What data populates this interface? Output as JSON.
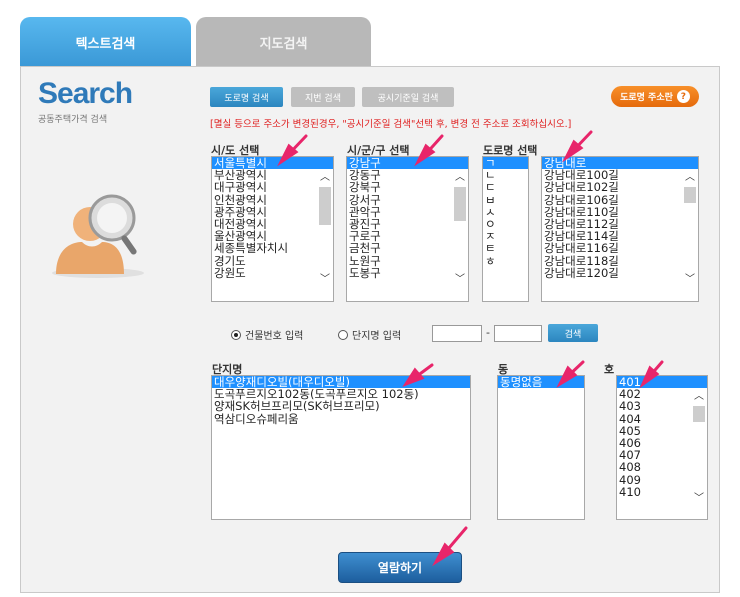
{
  "tabs": {
    "text_search": "텍스트검색",
    "map_search": "지도검색"
  },
  "brand": {
    "title": "Search",
    "subtitle": "공동주택가격 검색"
  },
  "buttons": {
    "road_search": "도로명 검색",
    "jibun_search": "지번 검색",
    "date_search": "공시기준일 검색",
    "road_address": "도로명 주소란",
    "search": "검색",
    "open": "열람하기"
  },
  "notice": "[멸실 등으로 주소가 변경된경우, \"공시기준일 검색\"선택 후, 변경 전 주소로 조회하십시오.]",
  "labels": {
    "sido": "시/도 선택",
    "sigungu": "시/군/구 선택",
    "road": "도로명 선택",
    "danji": "단지명",
    "dong": "동",
    "ho": "호"
  },
  "sido_list": [
    "서울특별시",
    "부산광역시",
    "대구광역시",
    "인천광역시",
    "광주광역시",
    "대전광역시",
    "울산광역시",
    "세종특별자치시",
    "경기도",
    "강원도"
  ],
  "sigungu_list": [
    "강남구",
    "강동구",
    "강북구",
    "강서구",
    "관악구",
    "광진구",
    "구로구",
    "금천구",
    "노원구",
    "도봉구"
  ],
  "initial_list": [
    "ㄱ",
    "ㄴ",
    "ㄷ",
    "ㅂ",
    "ㅅ",
    "ㅇ",
    "ㅈ",
    "ㅌ",
    "ㅎ"
  ],
  "road_list": [
    "강남대로",
    "강남대로100길",
    "강남대로102길",
    "강남대로106길",
    "강남대로110길",
    "강남대로112길",
    "강남대로114길",
    "강남대로116길",
    "강남대로118길",
    "강남대로120길"
  ],
  "radio": {
    "building_no": "건물번호 입력",
    "danji_name": "단지명 입력"
  },
  "danji_list": [
    "대우양재디오빌(대우디오빌)",
    "도곡푸르지오102동(도곡푸르지오 102동)",
    "양재SK허브프리모(SK허브프리모)",
    "역삼디오슈페리움"
  ],
  "dong_list": [
    "동명없음"
  ],
  "ho_list": [
    "401",
    "402",
    "403",
    "404",
    "405",
    "406",
    "407",
    "408",
    "409",
    "410"
  ],
  "colors": {
    "accent": "#3a98d6",
    "selected": "#1e90ff",
    "notice": "#e02020",
    "arrow": "#e8256a",
    "orange": "#e56a0c"
  }
}
